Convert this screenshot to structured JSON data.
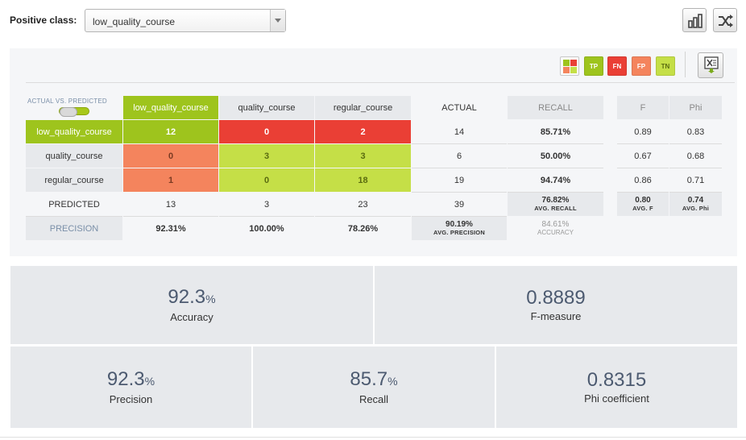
{
  "header": {
    "positive_class_label": "Positive class:",
    "positive_class_value": "low_quality_course",
    "chart_button_icon": "bar-chart-icon",
    "shuffle_button_icon": "shuffle-icon"
  },
  "legend": {
    "tp": "TP",
    "fn": "FN",
    "fp": "FP",
    "tn": "TN"
  },
  "colors": {
    "tp": "#9ec41d",
    "fn": "#ea3f35",
    "fp": "#f4845d",
    "tn": "#c5df47",
    "panel_bg": "#f5f6f8"
  },
  "matrix": {
    "toggle_label": "ACTUAL VS. PREDICTED",
    "columns": [
      "low_quality_course",
      "quality_course",
      "regular_course"
    ],
    "actual_header": "ACTUAL",
    "recall_header": "RECALL",
    "rows": [
      {
        "label": "low_quality_course",
        "cells": [
          "12",
          "0",
          "2"
        ],
        "actual": "14",
        "recall": "85.71%"
      },
      {
        "label": "quality_course",
        "cells": [
          "0",
          "3",
          "3"
        ],
        "actual": "6",
        "recall": "50.00%"
      },
      {
        "label": "regular_course",
        "cells": [
          "1",
          "0",
          "18"
        ],
        "actual": "19",
        "recall": "94.74%"
      }
    ],
    "predicted_label": "PREDICTED",
    "predicted": [
      "13",
      "3",
      "23"
    ],
    "total": "39",
    "avg_recall": {
      "value": "76.82%",
      "label": "AVG. RECALL"
    },
    "precision_label": "PRECISION",
    "precision": [
      "92.31%",
      "100.00%",
      "78.26%"
    ],
    "avg_precision": {
      "value": "90.19%",
      "label": "AVG. PRECISION"
    },
    "accuracy": {
      "value": "84.61%",
      "label": "ACCURACY"
    }
  },
  "side_table": {
    "headers": [
      "F",
      "Phi"
    ],
    "rows": [
      [
        "0.89",
        "0.83"
      ],
      [
        "0.67",
        "0.68"
      ],
      [
        "0.86",
        "0.71"
      ]
    ],
    "avg_f": {
      "value": "0.80",
      "label": "AVG. F"
    },
    "avg_phi": {
      "value": "0.74",
      "label": "AVG. Phi"
    }
  },
  "kpis": {
    "accuracy": {
      "value": "92.3",
      "unit": "%",
      "label": "Accuracy"
    },
    "fmeasure": {
      "value": "0.8889",
      "label": "F-measure"
    },
    "precision": {
      "value": "92.3",
      "unit": "%",
      "label": "Precision"
    },
    "recall": {
      "value": "85.7",
      "unit": "%",
      "label": "Recall"
    },
    "phi": {
      "value": "0.8315",
      "label": "Phi coefficient"
    }
  }
}
